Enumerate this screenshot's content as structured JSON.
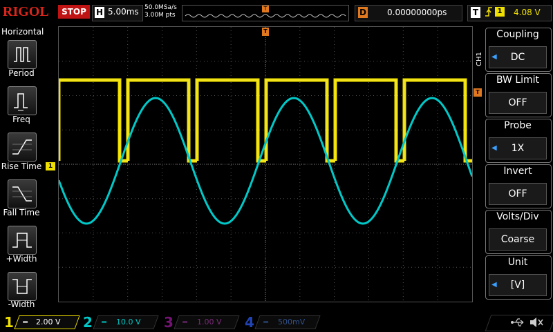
{
  "header": {
    "brand": "RIGOL",
    "run_state": "STOP",
    "timebase_letter": "H",
    "timebase": "5.00ms",
    "sample_rate": "50.0MSa/s",
    "memory_depth": "3.00M pts",
    "trigger_marker": "T",
    "delay_letter": "D",
    "delay_value": "0.00000000ps",
    "trigger_letter": "T",
    "trigger_edge": "rising-edge-icon",
    "trigger_source": "1",
    "trigger_level": "4.08 V"
  },
  "left_menu": {
    "title": "Horizontal",
    "items": [
      {
        "label": "Period",
        "icon": "period-icon"
      },
      {
        "label": "Freq",
        "icon": "frequency-icon"
      },
      {
        "label": "Rise Time",
        "icon": "rise-time-icon"
      },
      {
        "label": "Fall Time",
        "icon": "fall-time-icon"
      },
      {
        "label": "+Width",
        "icon": "positive-width-icon"
      },
      {
        "label": "-Width",
        "icon": "negative-width-icon"
      }
    ]
  },
  "right_menu": {
    "channel_label": "CH1",
    "items": [
      {
        "title": "Coupling",
        "value": "DC"
      },
      {
        "title": "BW Limit",
        "value": "OFF"
      },
      {
        "title": "Probe",
        "value": "1X"
      },
      {
        "title": "Invert",
        "value": "OFF"
      },
      {
        "title": "Volts/Div",
        "value": "Coarse"
      },
      {
        "title": "Unit",
        "value": "[V]"
      }
    ]
  },
  "grid_markers": {
    "ch1_marker": "1",
    "trigger_position_marker": "T",
    "trigger_level_marker": "T"
  },
  "bottom_bar": {
    "channels": [
      {
        "number": "1",
        "coupling_symbol": "=",
        "scale": "2.00 V",
        "color": "#f0e000"
      },
      {
        "number": "2",
        "coupling_symbol": "=",
        "scale": "10.0 V",
        "color": "#00c8c8"
      },
      {
        "number": "3",
        "coupling_symbol": "=",
        "scale": "1.00 V",
        "color": "#c020c0"
      },
      {
        "number": "4",
        "coupling_symbol": "=",
        "scale": "500mV",
        "color": "#3060ff"
      }
    ],
    "usb_icon": "usb-icon",
    "speaker_icon": "speaker-muted-icon"
  },
  "colors": {
    "ch1": "#f0e000",
    "ch2": "#00c8c8",
    "ch3": "#c020c0",
    "ch4": "#3060ff",
    "trigger": "#e07820",
    "stop": "#c01414"
  }
}
